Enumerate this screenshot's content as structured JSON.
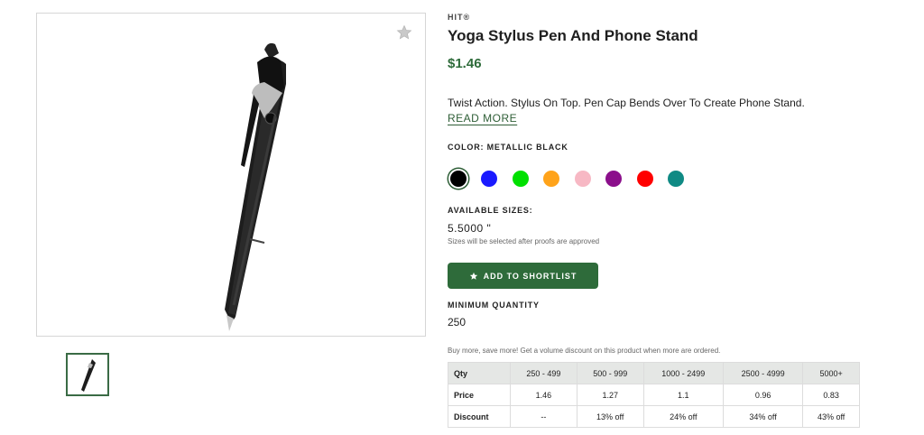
{
  "product": {
    "brand": "HIT®",
    "title": "Yoga Stylus Pen And Phone Stand",
    "price": "$1.46",
    "description": "Twist Action. Stylus On Top. Pen Cap Bends Over To Create Phone Stand.",
    "read_more": "READ MORE"
  },
  "color": {
    "label": "COLOR: METALLIC BLACK",
    "swatches": [
      {
        "name": "black",
        "hex": "#000000",
        "selected": true
      },
      {
        "name": "blue",
        "hex": "#1a1aff"
      },
      {
        "name": "green",
        "hex": "#00e000"
      },
      {
        "name": "orange",
        "hex": "#ffa31a"
      },
      {
        "name": "pink",
        "hex": "#f7b8c4"
      },
      {
        "name": "purple",
        "hex": "#8b0f8b"
      },
      {
        "name": "red",
        "hex": "#ff0000"
      },
      {
        "name": "teal",
        "hex": "#0f8a84"
      }
    ]
  },
  "sizes": {
    "label": "AVAILABLE SIZES:",
    "value": "5.5000 \"",
    "note": "Sizes will be selected after proofs are approved"
  },
  "shortlist": {
    "label": "ADD TO SHORTLIST",
    "icon": "star-icon"
  },
  "minimum": {
    "label": "MINIMUM QUANTITY",
    "value": "250"
  },
  "volume_note": "Buy more, save more! Get a volume discount on this product when more are ordered.",
  "pricing_table": {
    "headers": [
      "Qty",
      "250 - 499",
      "500 - 999",
      "1000 - 2499",
      "2500 - 4999",
      "5000+"
    ],
    "rows": [
      [
        "Price",
        "1.46",
        "1.27",
        "1.1",
        "0.96",
        "0.83"
      ],
      [
        "Discount",
        "--",
        "13% off",
        "24% off",
        "34% off",
        "43% off"
      ]
    ]
  },
  "colors": {
    "accent": "#2e6b3a",
    "table_header_bg": "#e5e7e5"
  }
}
